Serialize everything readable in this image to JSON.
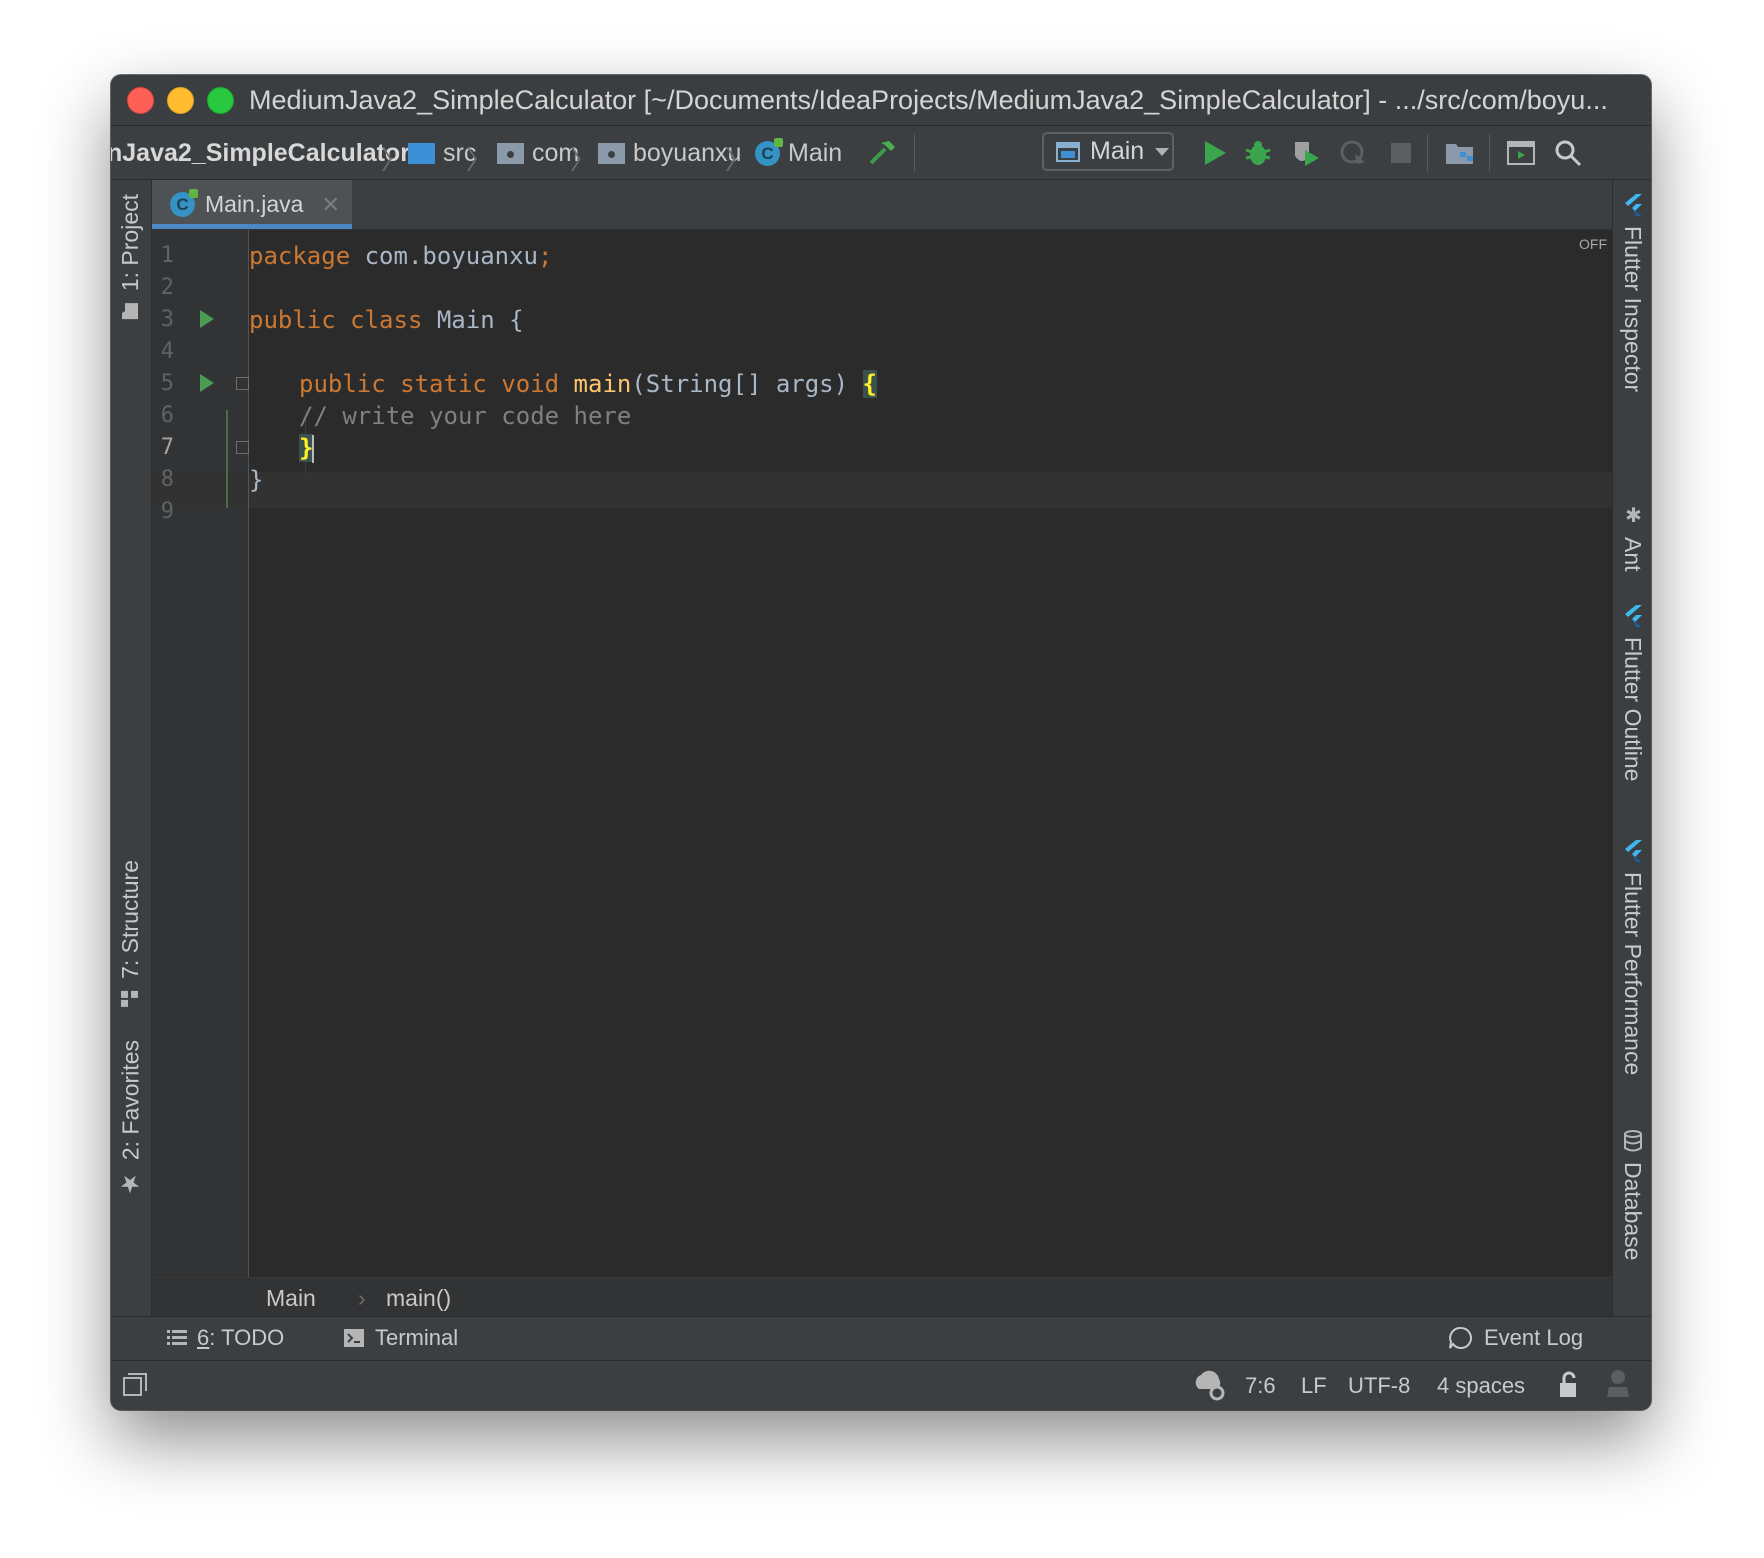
{
  "window": {
    "title": "MediumJava2_SimpleCalculator [~/Documents/IdeaProjects/MediumJava2_SimpleCalculator] - .../src/com/boyu..."
  },
  "navbar": {
    "breadcrumbs": [
      "nJava2_SimpleCalculator",
      "src",
      "com",
      "boyuanxu",
      "Main"
    ],
    "run_config": "Main"
  },
  "left_stripe": {
    "project": "1: Project",
    "structure": "7: Structure",
    "favorites": "2: Favorites"
  },
  "right_stripe": {
    "flutter_inspector": "Flutter Inspector",
    "ant": "Ant",
    "flutter_outline": "Flutter Outline",
    "flutter_performance": "Flutter Performance",
    "database": "Database"
  },
  "tabs": [
    {
      "label": "Main.java",
      "active": true
    }
  ],
  "editor": {
    "off_label": "OFF",
    "line_numbers": [
      "1",
      "2",
      "3",
      "4",
      "5",
      "6",
      "7",
      "8",
      "9"
    ],
    "lines": {
      "l1_kw": "package",
      "l1_rest": " com.boyuanxu",
      "l1_semi": ";",
      "l3_kw": "public class",
      "l3_name": " Main {",
      "l5_kw": "public static void",
      "l5_fn": "main",
      "l5_args": "(String[] args) ",
      "l5_brace": "{",
      "l6_comment": "// write your code here",
      "l7_brace": "}",
      "l8_brace": "}"
    },
    "current_line": 7
  },
  "editor_breadcrumbs": {
    "class": "Main",
    "method": "main()"
  },
  "bottom_tools": {
    "todo_number": "6",
    "todo_label": ": TODO",
    "terminal": "Terminal",
    "event_log": "Event Log"
  },
  "statusbar": {
    "position": "7:6",
    "line_sep": "LF",
    "encoding": "UTF-8",
    "indent": "4 spaces"
  },
  "colors": {
    "keyword": "#cc7832",
    "identifier": "#a9b7c6",
    "function": "#ffc66d",
    "comment": "#808080",
    "run_green": "#499c54",
    "accent_blue": "#4a88c7"
  }
}
